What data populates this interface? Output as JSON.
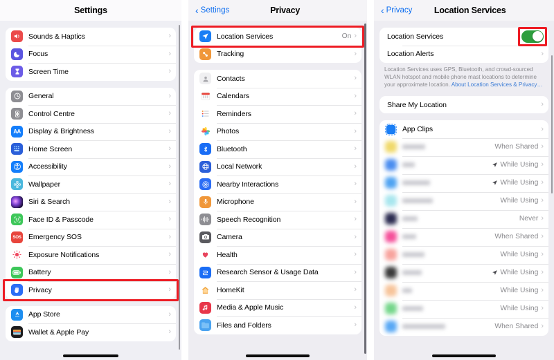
{
  "panels": {
    "settings": {
      "nav_title": "Settings",
      "groups": [
        {
          "items": [
            {
              "label": "Sounds & Haptics",
              "icon": "speaker-icon"
            },
            {
              "label": "Focus",
              "icon": "moon-icon"
            },
            {
              "label": "Screen Time",
              "icon": "hourglass-icon"
            }
          ]
        },
        {
          "items": [
            {
              "label": "General",
              "icon": "gear-icon"
            },
            {
              "label": "Control Centre",
              "icon": "sliders-icon"
            },
            {
              "label": "Display & Brightness",
              "icon": "aa-icon"
            },
            {
              "label": "Home Screen",
              "icon": "grid-icon"
            },
            {
              "label": "Accessibility",
              "icon": "accessibility-icon"
            },
            {
              "label": "Wallpaper",
              "icon": "flower-icon"
            },
            {
              "label": "Siri & Search",
              "icon": "siri-icon"
            },
            {
              "label": "Face ID & Passcode",
              "icon": "faceid-icon"
            },
            {
              "label": "Emergency SOS",
              "icon": "sos-icon"
            },
            {
              "label": "Exposure Notifications",
              "icon": "exposure-icon"
            },
            {
              "label": "Battery",
              "icon": "battery-icon"
            },
            {
              "label": "Privacy",
              "icon": "hand-icon",
              "highlighted": true
            }
          ]
        },
        {
          "items": [
            {
              "label": "App Store",
              "icon": "appstore-icon"
            },
            {
              "label": "Wallet & Apple Pay",
              "icon": "wallet-icon"
            }
          ]
        }
      ]
    },
    "privacy": {
      "nav_back": "Settings",
      "nav_title": "Privacy",
      "groups": [
        {
          "items": [
            {
              "label": "Location Services",
              "value": "On",
              "icon": "location-arrow-icon",
              "highlighted": true
            },
            {
              "label": "Tracking",
              "value": "",
              "icon": "tracking-icon"
            }
          ]
        },
        {
          "items": [
            {
              "label": "Contacts",
              "icon": "contacts-icon"
            },
            {
              "label": "Calendars",
              "icon": "calendar-icon"
            },
            {
              "label": "Reminders",
              "icon": "reminders-icon"
            },
            {
              "label": "Photos",
              "icon": "photos-icon"
            },
            {
              "label": "Bluetooth",
              "icon": "bluetooth-icon"
            },
            {
              "label": "Local Network",
              "icon": "network-icon"
            },
            {
              "label": "Nearby Interactions",
              "icon": "nearby-icon"
            },
            {
              "label": "Microphone",
              "icon": "microphone-icon"
            },
            {
              "label": "Speech Recognition",
              "icon": "waveform-icon"
            },
            {
              "label": "Camera",
              "icon": "camera-icon"
            },
            {
              "label": "Health",
              "icon": "heart-icon"
            },
            {
              "label": "Research Sensor & Usage Data",
              "icon": "research-icon"
            },
            {
              "label": "HomeKit",
              "icon": "home-icon"
            },
            {
              "label": "Media & Apple Music",
              "icon": "music-icon"
            },
            {
              "label": "Files and Folders",
              "icon": "folder-icon"
            }
          ]
        }
      ]
    },
    "location": {
      "nav_back": "Privacy",
      "nav_title": "Location Services",
      "toggle_row": {
        "label": "Location Services",
        "enabled": true,
        "highlighted": true
      },
      "alerts_row": {
        "label": "Location Alerts"
      },
      "footnote": "Location Services uses GPS, Bluetooth, and crowd-sourced WLAN hotspot and mobile phone mast locations to determine your approximate location. ",
      "footnote_link": "About Location Services & Privacy…",
      "share_row": {
        "label": "Share My Location"
      },
      "apps": [
        {
          "label": "App Clips",
          "value": "",
          "blurred": false,
          "color": "#1a7ef5",
          "name_w": 0
        },
        {
          "label": "",
          "value": "When Shared",
          "blurred": true,
          "color": "#f0d96a",
          "name_w": 33,
          "arrow": false
        },
        {
          "label": "",
          "value": "While Using",
          "blurred": true,
          "color": "#4a8df0",
          "name_w": 18,
          "arrow": true
        },
        {
          "label": "",
          "value": "While Using",
          "blurred": true,
          "color": "#4fa3f2",
          "name_w": 40,
          "arrow": true
        },
        {
          "label": "",
          "value": "While Using",
          "blurred": true,
          "color": "#a8e6ee",
          "name_w": 44,
          "arrow": false
        },
        {
          "label": "",
          "value": "Never",
          "blurred": true,
          "color": "#2b2b50",
          "name_w": 22,
          "arrow": false
        },
        {
          "label": "",
          "value": "When Shared",
          "blurred": true,
          "color": "#f5509a",
          "name_w": 20,
          "arrow": false
        },
        {
          "label": "",
          "value": "While Using",
          "blurred": true,
          "color": "#f8a39d",
          "name_w": 32,
          "arrow": false
        },
        {
          "label": "",
          "value": "While Using",
          "blurred": true,
          "color": "#3a3a3a",
          "name_w": 28,
          "arrow": true
        },
        {
          "label": "",
          "value": "While Using",
          "blurred": true,
          "color": "#f7c49a",
          "name_w": 14,
          "arrow": false
        },
        {
          "label": "",
          "value": "While Using",
          "blurred": true,
          "color": "#74d68a",
          "name_w": 30,
          "arrow": false
        },
        {
          "label": "",
          "value": "When Shared",
          "blurred": true,
          "color": "#57a8f5",
          "name_w": 62,
          "arrow": false
        }
      ]
    }
  },
  "colors": {
    "accent_blue": "#0a6cf0",
    "highlight_red": "#ed1c24",
    "toggle_green": "#2e9e3e",
    "chevron_grey": "#c2c2c6"
  }
}
